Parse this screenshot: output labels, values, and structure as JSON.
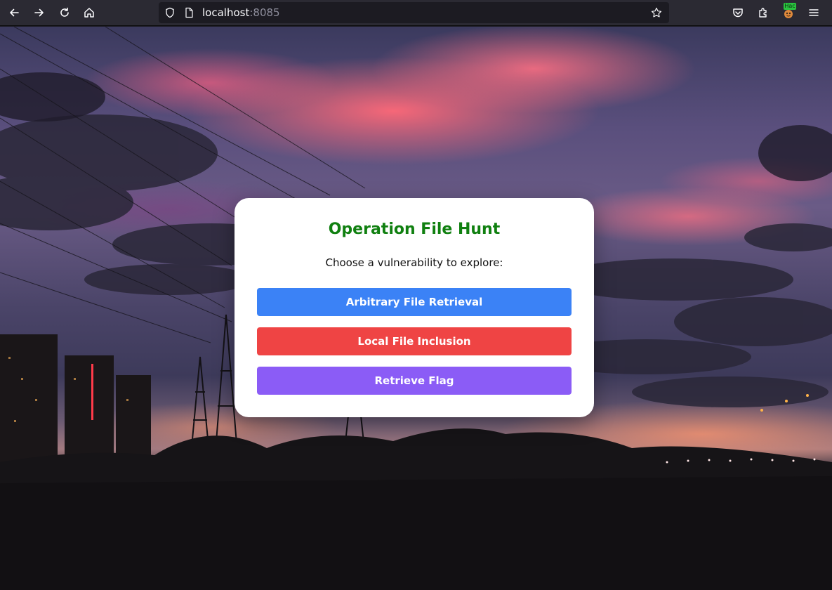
{
  "browser": {
    "url_host": "localhost",
    "url_port": ":8085",
    "extension_badge": "Hac"
  },
  "icons": {
    "back": "back-arrow-icon",
    "forward": "forward-arrow-icon",
    "reload": "reload-icon",
    "home": "home-icon",
    "shield": "shield-icon",
    "page": "page-icon",
    "bookmark": "star-icon",
    "pocket": "pocket-icon",
    "extensions": "puzzle-icon",
    "menu": "hamburger-menu-icon"
  },
  "card": {
    "title": "Operation File Hunt",
    "subtitle": "Choose a vulnerability to explore:",
    "buttons": [
      {
        "label": "Arbitrary File Retrieval",
        "color": "#3b82f6"
      },
      {
        "label": "Local File Inclusion",
        "color": "#ef4444"
      },
      {
        "label": "Retrieve Flag",
        "color": "#8b5cf6"
      }
    ]
  },
  "colors": {
    "title": "#108010",
    "toolbar_bg": "#2b2a33",
    "urlbar_bg": "#1c1b22"
  }
}
